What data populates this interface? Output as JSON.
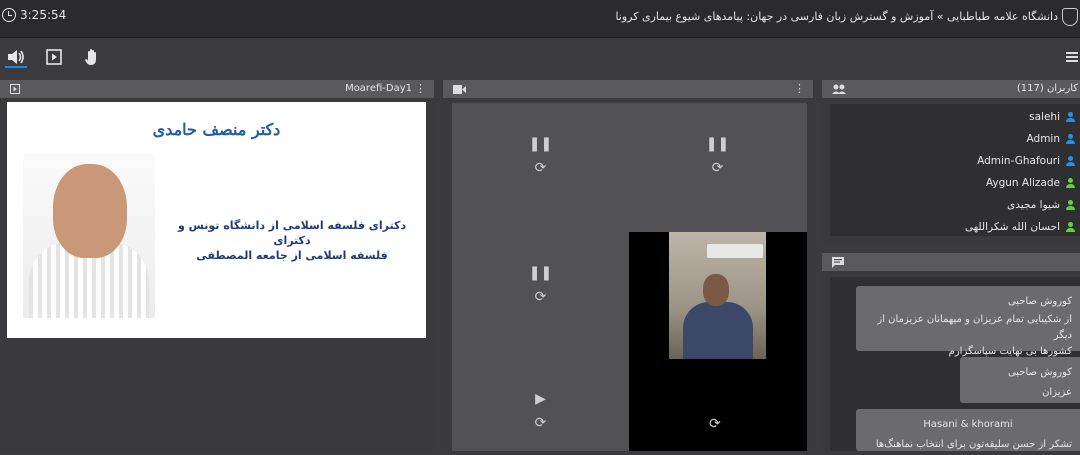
{
  "header": {
    "timer": "3:25:54",
    "title": "دانشگاه علامه طباطبایی » آموزش و گسترش زبان فارسی در جهان: پیامدهای شیوع بیماری کرونا"
  },
  "toolbar": {
    "items": [
      "audio-icon",
      "video-share-icon",
      "raise-hand-icon"
    ]
  },
  "share": {
    "title": "Moarefi-Day1",
    "slide_name": "دکتر منصف حامدی",
    "slide_line1": "دکترای فلسفه اسلامی از دانشگاه تونس و دکترای",
    "slide_line2": "فلسفه اسلامی از جامعه المصطفی"
  },
  "users": {
    "title": "کاربران (117)",
    "list": [
      {
        "name": "salehi",
        "color": "#2a8de6"
      },
      {
        "name": "Admin",
        "color": "#2a8de6"
      },
      {
        "name": "Admin-Ghafouri",
        "color": "#2a8de6"
      },
      {
        "name": "Aygun Alizade",
        "color": "#5fd33b"
      },
      {
        "name": "شیوا مجیدی",
        "color": "#5fd33b"
      },
      {
        "name": "احسان الله شکراللهی",
        "color": "#5fd33b"
      }
    ]
  },
  "chat": {
    "messages": [
      {
        "author": "کوروش صاحبی",
        "text1": "از شکیبایی تمام عزیزان و میهمانان عزیزمان از دیگر",
        "text2": "کشورها بی نهایت سپاسگزارم"
      },
      {
        "author": "کوروش صاحبی",
        "text1": "عزیزان",
        "text2": ""
      },
      {
        "author": "Hasani & khorami",
        "text1": "تشکر از حسن سلیقه‌تون برای انتخاب نماهنگ‌ها",
        "text2": ""
      }
    ]
  }
}
